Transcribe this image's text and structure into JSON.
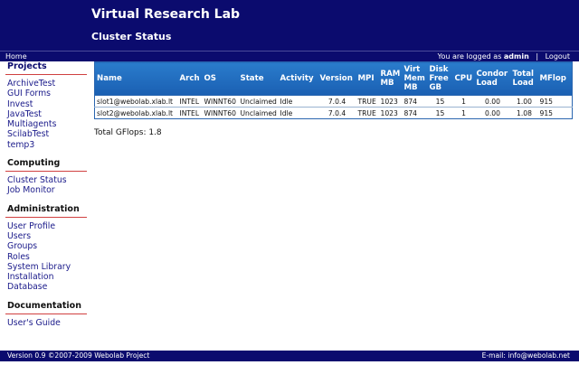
{
  "header": {
    "site_title": "Virtual Research Lab",
    "page_title": "Cluster Status"
  },
  "topbar": {
    "home": "Home",
    "logged_prefix": "You are logged as",
    "user": "admin",
    "separator": "|",
    "logout": "Logout"
  },
  "sidebar": {
    "projects": {
      "title": "Projects",
      "items": [
        "ArchiveTest",
        "GUI Forms",
        "Invest",
        "JavaTest",
        "Multiagents",
        "ScilabTest",
        "temp3"
      ]
    },
    "computing": {
      "title": "Computing",
      "items": [
        "Cluster Status",
        "Job Monitor"
      ]
    },
    "administration": {
      "title": "Administration",
      "items": [
        "User Profile",
        "Users",
        "Groups",
        "Roles",
        "System Library",
        "Installation",
        "Database"
      ]
    },
    "documentation": {
      "title": "Documentation",
      "items": [
        "User's Guide"
      ]
    }
  },
  "table": {
    "headers": [
      "Name",
      "Arch",
      "OS",
      "State",
      "Activity",
      "Version",
      "MPI",
      "RAM MB",
      "Virt Mem MB",
      "Disk Free GB",
      "CPU",
      "Condor Load",
      "Total Load",
      "MFlop"
    ],
    "rows": [
      [
        "slot1@webolab.xlab.lt",
        "INTEL",
        "WINNT60",
        "Unclaimed",
        "Idle",
        "7.0.4",
        "TRUE",
        "1023",
        "874",
        "15",
        "1",
        "0.00",
        "1.00",
        "915"
      ],
      [
        "slot2@webolab.xlab.lt",
        "INTEL",
        "WINNT60",
        "Unclaimed",
        "Idle",
        "7.0.4",
        "TRUE",
        "1023",
        "874",
        "15",
        "1",
        "0.00",
        "1.08",
        "915"
      ]
    ]
  },
  "total_gflops": "Total GFlops: 1.8",
  "footer": {
    "left": "Version 0.9   ©2007-2009 Webolab Project",
    "right": "E-mail: info@webolab.net"
  },
  "colors": {
    "header_bg": "#0b0b6e",
    "table_header": "#2a7ccc",
    "link": "#1a1a8a",
    "section_rule": "#d04040"
  }
}
